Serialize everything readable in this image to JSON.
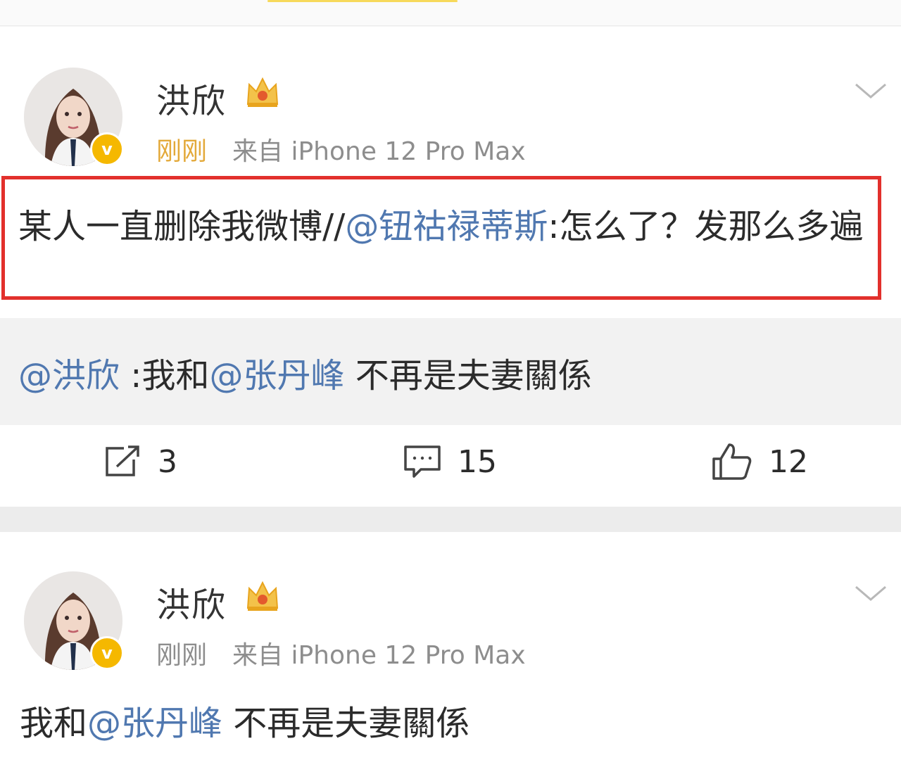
{
  "colors": {
    "mention": "#5078b0",
    "highlight_box": "#e2302c",
    "verified_badge": "#f5b800",
    "time_highlight": "#e3a93a"
  },
  "posts": [
    {
      "username": "洪欣",
      "time": "刚刚",
      "source": "来自 iPhone 12 Pro Max",
      "verified_icon": "v",
      "content": {
        "text_before": "某人一直删除我微博//",
        "mention": "@钮祜禄蒂斯",
        "text_after": ":怎么了？发那么多遍"
      },
      "repost": {
        "author_mention": "@洪欣",
        "sep": " :我和",
        "mention": "@张丹峰",
        "text": " 不再是夫妻關係"
      },
      "actions": {
        "share_count": "3",
        "comment_count": "15",
        "like_count": "12"
      }
    },
    {
      "username": "洪欣",
      "time": "刚刚",
      "source": "来自 iPhone 12 Pro Max",
      "verified_icon": "v",
      "content": {
        "text_before": "我和",
        "mention": "@张丹峰",
        "text_after": " 不再是夫妻關係"
      }
    }
  ]
}
